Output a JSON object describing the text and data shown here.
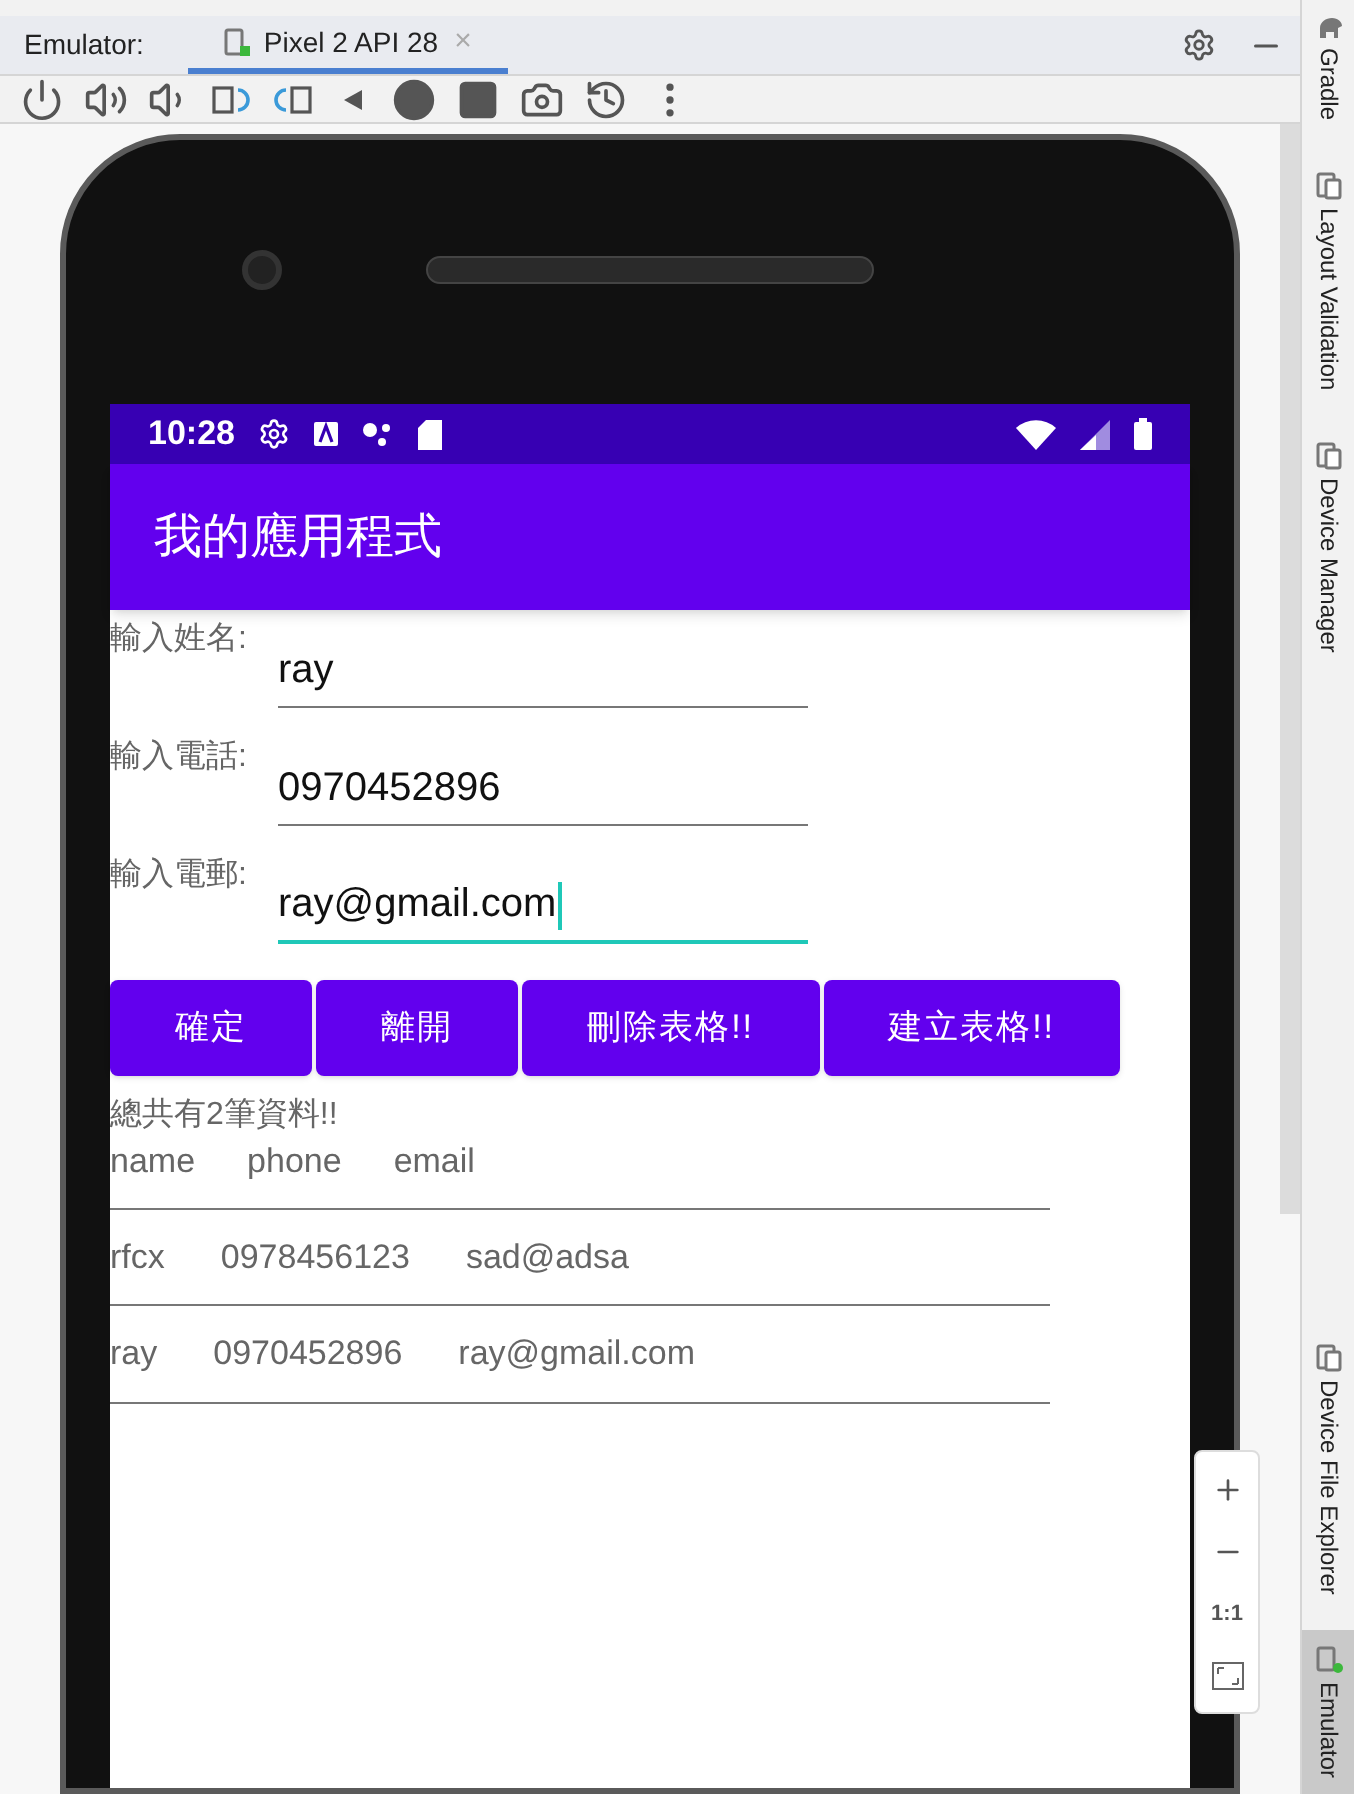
{
  "ide": {
    "label": "Emulator:",
    "tab": {
      "title": "Pixel 2 API 28",
      "selected": true,
      "close": "×"
    }
  },
  "side_tools_top": [
    {
      "label": "Gradle",
      "kind": "gradle",
      "selected": false
    },
    {
      "label": "Layout Validation",
      "kind": "device",
      "selected": false
    },
    {
      "label": "Device Manager",
      "kind": "device",
      "selected": false
    }
  ],
  "side_tools_bottom": [
    {
      "label": "Device File Explorer",
      "kind": "device",
      "selected": false
    },
    {
      "label": "Emulator",
      "kind": "emulator",
      "selected": true
    }
  ],
  "zoom_controls": {
    "actual_size": "1:1"
  },
  "phone": {
    "status_bar": {
      "time": "10:28"
    },
    "app_bar": {
      "title": "我的應用程式"
    },
    "form": [
      {
        "label": "輸入姓名:",
        "value": "ray",
        "focused": false
      },
      {
        "label": "輸入電話:",
        "value": "0970452896",
        "focused": false
      },
      {
        "label": "輸入電郵:",
        "value": "ray@gmail.com",
        "focused": true
      }
    ],
    "buttons": [
      "確定",
      "離開",
      "刪除表格!!",
      "建立表格!!"
    ],
    "summary": "總共有2筆資料!!",
    "table": {
      "columns": [
        "name",
        "phone",
        "email"
      ],
      "rows": [
        [
          "rfcx",
          "0978456123",
          "sad@adsa"
        ],
        [
          "ray",
          "0970452896",
          "ray@gmail.com"
        ]
      ]
    }
  }
}
